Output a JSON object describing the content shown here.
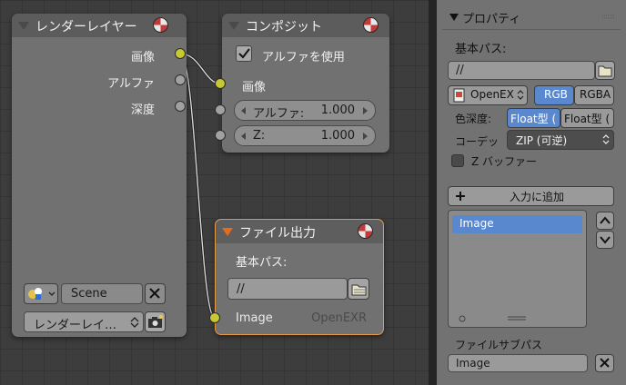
{
  "nodes": {
    "render_layers": {
      "title": "レンダーレイヤー",
      "outputs": [
        "画像",
        "アルファ",
        "深度"
      ],
      "scene": "Scene",
      "layer": "レンダーレイ…"
    },
    "composite": {
      "title": "コンポジット",
      "use_alpha_label": "アルファを使用",
      "use_alpha_checked": true,
      "input_image": "画像",
      "alpha_label": "アルファ:",
      "alpha_value": "1.000",
      "z_label": "Z:",
      "z_value": "1.000"
    },
    "file_output": {
      "title": "ファイル出力",
      "base_path_label": "基本パス:",
      "base_path_value": "//",
      "input_name": "Image",
      "input_format": "OpenEXR"
    }
  },
  "properties": {
    "header": "プロパティ",
    "base_path_label": "基本パス:",
    "base_path_value": "//",
    "format": "OpenEX",
    "color_mode_options": [
      "RGB",
      "RGBA"
    ],
    "color_mode_selected": "RGB",
    "color_depth_label": "色深度:",
    "color_depth_options": [
      "Float型 (",
      "Float型 ("
    ],
    "color_depth_selected": "Float型 (",
    "codec_label": "コーデッ",
    "codec_value": "ZIP (可逆)",
    "zbuffer_label": "Z バッファー",
    "zbuffer_checked": false,
    "add_input_label": "入力に追加",
    "inputs_list": [
      "Image"
    ],
    "file_subpath_label": "ファイルサブパス",
    "file_subpath_value": "Image"
  },
  "colors": {
    "socket_image": "#c8c832",
    "socket_value": "#a1a1a1",
    "selected_blue": "#5a88cf",
    "active_node_border": "#e59a4a"
  }
}
